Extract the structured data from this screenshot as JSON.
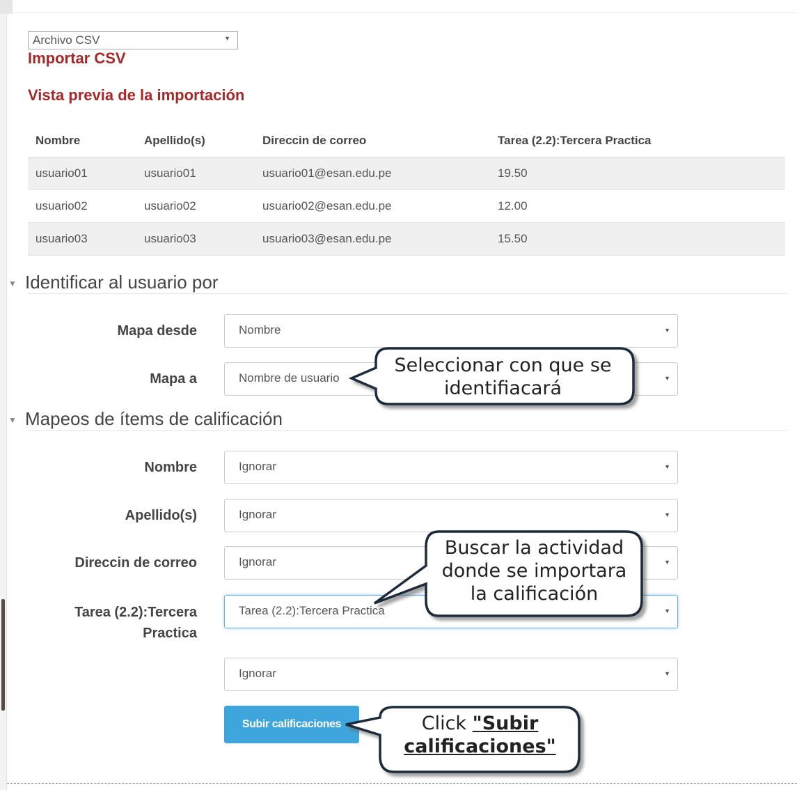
{
  "import_source": {
    "selected": "Archivo CSV"
  },
  "headings": {
    "import_csv": "Importar CSV",
    "preview": "Vista previa de la importación"
  },
  "preview_table": {
    "headers": [
      "Nombre",
      "Apellido(s)",
      "Direccin de correo",
      "Tarea (2.2):Tercera Practica"
    ],
    "rows": [
      [
        "usuario01",
        "usuario01",
        "usuario01@esan.edu.pe",
        "19.50"
      ],
      [
        "usuario02",
        "usuario02",
        "usuario02@esan.edu.pe",
        "12.00"
      ],
      [
        "usuario03",
        "usuario03",
        "usuario03@esan.edu.pe",
        "15.50"
      ]
    ]
  },
  "identify_section": {
    "title": "Identificar al usuario por",
    "map_from_label": "Mapa desde",
    "map_from_value": "Nombre",
    "map_to_label": "Mapa a",
    "map_to_value": "Nombre de usuario"
  },
  "mapping_section": {
    "title": "Mapeos de ítems de calificación",
    "fields": [
      {
        "label": "Nombre",
        "value": "Ignorar"
      },
      {
        "label": "Apellido(s)",
        "value": "Ignorar"
      },
      {
        "label": "Direccin de correo",
        "value": "Ignorar"
      },
      {
        "label": "Tarea (2.2):Tercera Practica",
        "value": "Tarea (2.2):Tercera Practica"
      },
      {
        "label": "",
        "value": "Ignorar"
      }
    ]
  },
  "submit_label": "Subir calificaciones",
  "callouts": {
    "identify_line1": "Seleccionar con que se",
    "identify_line2": "identifiacará",
    "activity_line1": "Buscar la actividad",
    "activity_line2": "donde se importara",
    "activity_line3": "la calificación",
    "click_prefix": "Click ",
    "click_bold1": "\"Subir",
    "click_bold2": "calificaciones\""
  }
}
